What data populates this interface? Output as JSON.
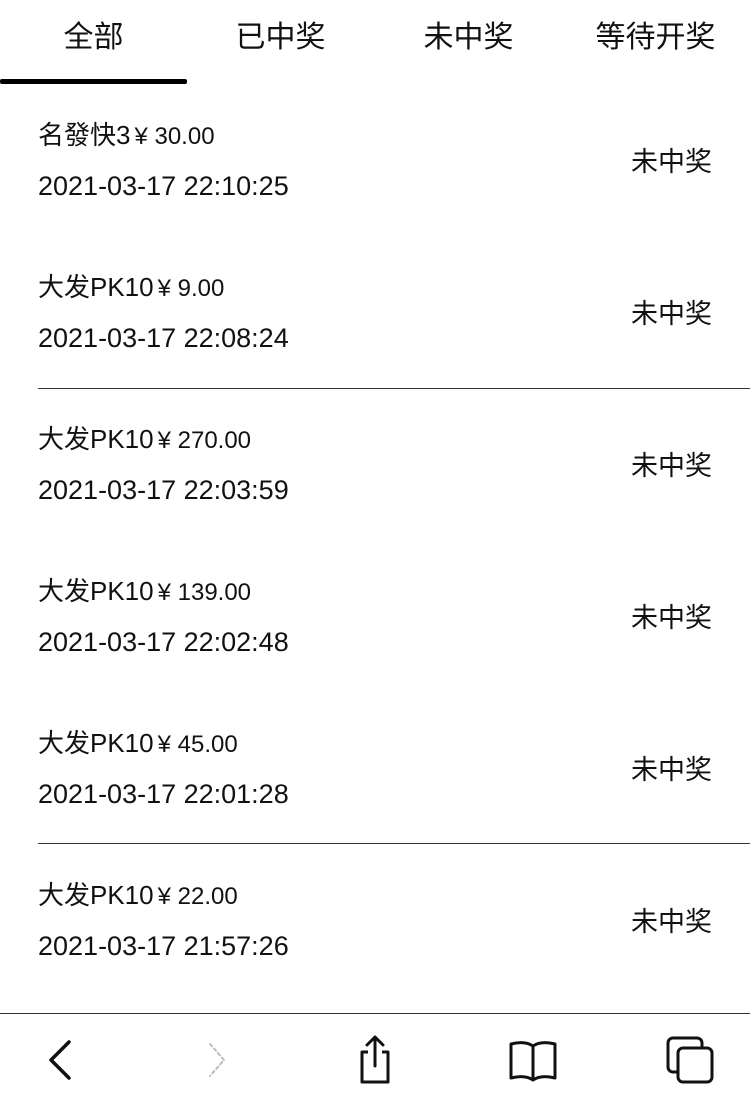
{
  "tabs": [
    {
      "label": "全部",
      "selected": true
    },
    {
      "label": "已中奖",
      "selected": false
    },
    {
      "label": "未中奖",
      "selected": false
    },
    {
      "label": "等待开奖",
      "selected": false
    }
  ],
  "records": [
    {
      "lottery": "名發快3",
      "amount": "¥ 30.00",
      "time": "2021-03-17 22:10:25",
      "status": "未中奖"
    },
    {
      "lottery": "大发PK10",
      "amount": "¥ 9.00",
      "time": "2021-03-17 22:08:24",
      "status": "未中奖"
    },
    {
      "lottery": "大发PK10",
      "amount": "¥ 270.00",
      "time": "2021-03-17 22:03:59",
      "status": "未中奖"
    },
    {
      "lottery": "大发PK10",
      "amount": "¥ 139.00",
      "time": "2021-03-17 22:02:48",
      "status": "未中奖"
    },
    {
      "lottery": "大发PK10",
      "amount": "¥ 45.00",
      "time": "2021-03-17 22:01:28",
      "status": "未中奖"
    },
    {
      "lottery": "大发PK10",
      "amount": "¥ 22.00",
      "time": "2021-03-17 21:57:26",
      "status": "未中奖"
    }
  ],
  "browser_toolbar": {
    "icons": [
      "back-icon",
      "forward-icon",
      "share-icon",
      "bookmarks-icon",
      "tabs-icon"
    ],
    "forward_enabled": false
  },
  "colors": {
    "text": "#111111",
    "divider": "#333333",
    "indicator": "#000000",
    "background": "#ffffff"
  }
}
